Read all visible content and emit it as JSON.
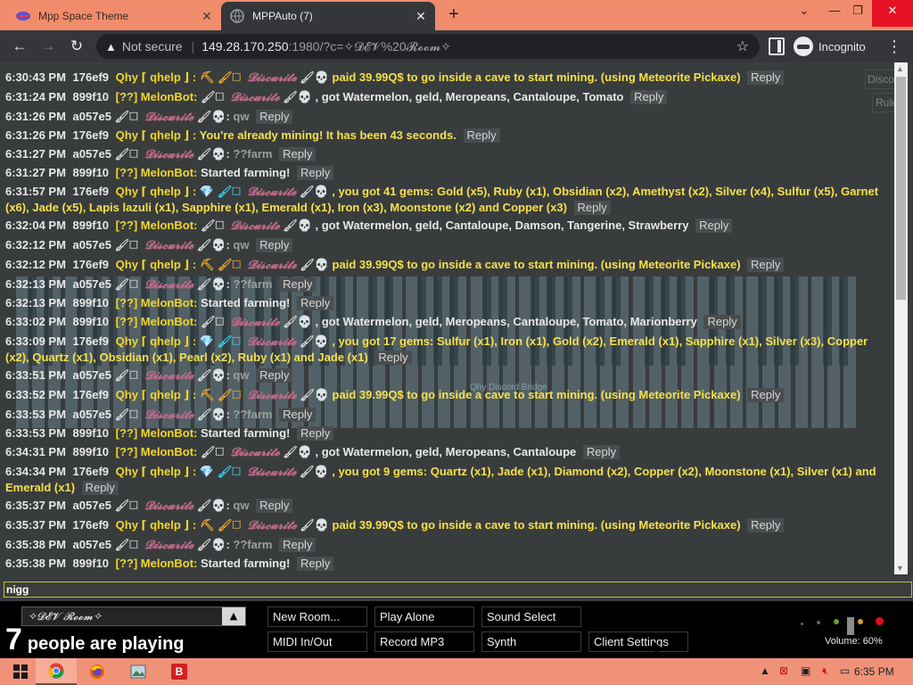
{
  "browser": {
    "tabs": [
      {
        "title": "Mpp Space Theme",
        "active": false
      },
      {
        "title": "MPPAuto (7)",
        "active": true
      }
    ],
    "address": {
      "security": "Not secure",
      "host": "149.28.170.250",
      "path": ":1980/?c=✧𝓓𝓔𝓥%20𝓡𝓸𝓸𝓶✧"
    },
    "profile_label": "Incognito"
  },
  "side_buttons": {
    "discord": "Discord",
    "rules": "Rules"
  },
  "piano_label": "Qhy Discord Bridge",
  "chat": {
    "messages": [
      {
        "time": "6:30:43 PM",
        "uid": "176ef9",
        "name": "Qhy ⌈ qhelp ⌋ :",
        "icons": "⛏ 🖌🗆",
        "target": "𝓓𝓲𝓼𝓬𝓾𝓻𝓲𝓽𝓮",
        "target_icons": "🖌💀",
        "text": "paid 39.99Q$ to go inside a cave to start mining. (using Meteorite Pickaxe)",
        "kind": "qhy"
      },
      {
        "time": "6:31:24 PM",
        "uid": "899f10",
        "name": "[??] MelonBot:",
        "icons": "🖌🗆",
        "target": "𝓓𝓲𝓼𝓬𝓾𝓻𝓲𝓽𝓮",
        "target_icons": "🖌💀",
        "text": ", got Watermelon, geld, Meropeans, Cantaloupe, Tomato",
        "kind": "melon"
      },
      {
        "time": "6:31:26 PM",
        "uid": "a057e5",
        "name": "",
        "icons": "🖌🗆",
        "target": "𝓓𝓲𝓼𝓬𝓾𝓻𝓲𝓽𝓮",
        "target_icons": "🖌💀:",
        "text": "qw",
        "kind": "disc"
      },
      {
        "time": "6:31:26 PM",
        "uid": "176ef9",
        "name": "Qhy ⌈ qhelp ⌋ :",
        "icons": "",
        "target": "",
        "target_icons": "",
        "text": "You're already mining! It has been 43 seconds.",
        "kind": "qhy"
      },
      {
        "time": "6:31:27 PM",
        "uid": "a057e5",
        "name": "",
        "icons": "🖌🗆",
        "target": "𝓓𝓲𝓼𝓬𝓾𝓻𝓲𝓽𝓮",
        "target_icons": "🖌💀:",
        "text": "??farm",
        "kind": "disc"
      },
      {
        "time": "6:31:27 PM",
        "uid": "899f10",
        "name": "[??] MelonBot:",
        "icons": "",
        "target": "",
        "target_icons": "",
        "text": "Started farming!",
        "kind": "melon_plain"
      },
      {
        "time": "6:31:57 PM",
        "uid": "176ef9",
        "name": "Qhy ⌈ qhelp ⌋ :",
        "icons": "💎 🖌🗆",
        "target": "𝓓𝓲𝓼𝓬𝓾𝓻𝓲𝓽𝓮",
        "target_icons": "🖌💀",
        "text": ", you got 41 gems: Gold (x5), Ruby (x1), Obsidian (x2), Amethyst (x2), Silver (x4), Sulfur (x5), Garnet (x6), Jade (x5), Lapis lazuli (x1), Sapphire (x1), Emerald (x1), Iron (x3), Moonstone (x2) and Copper (x3)",
        "kind": "qhy"
      },
      {
        "time": "6:32:04 PM",
        "uid": "899f10",
        "name": "[??] MelonBot:",
        "icons": "🖌🗆",
        "target": "𝓓𝓲𝓼𝓬𝓾𝓻𝓲𝓽𝓮",
        "target_icons": "🖌💀",
        "text": ", got Watermelon, geld, Cantaloupe, Damson, Tangerine, Strawberry",
        "kind": "melon"
      },
      {
        "time": "6:32:12 PM",
        "uid": "a057e5",
        "name": "",
        "icons": "🖌🗆",
        "target": "𝓓𝓲𝓼𝓬𝓾𝓻𝓲𝓽𝓮",
        "target_icons": "🖌💀:",
        "text": "qw",
        "kind": "disc"
      },
      {
        "time": "6:32:12 PM",
        "uid": "176ef9",
        "name": "Qhy ⌈ qhelp ⌋ :",
        "icons": "⛏ 🖌🗆",
        "target": "𝓓𝓲𝓼𝓬𝓾𝓻𝓲𝓽𝓮",
        "target_icons": "🖌💀",
        "text": "paid 39.99Q$ to go inside a cave to start mining. (using Meteorite Pickaxe)",
        "kind": "qhy"
      },
      {
        "time": "6:32:13 PM",
        "uid": "a057e5",
        "name": "",
        "icons": "🖌🗆",
        "target": "𝓓𝓲𝓼𝓬𝓾𝓻𝓲𝓽𝓮",
        "target_icons": "🖌💀:",
        "text": "??farm",
        "kind": "disc"
      },
      {
        "time": "6:32:13 PM",
        "uid": "899f10",
        "name": "[??] MelonBot:",
        "icons": "",
        "target": "",
        "target_icons": "",
        "text": "Started farming!",
        "kind": "melon_plain"
      },
      {
        "time": "6:33:02 PM",
        "uid": "899f10",
        "name": "[??] MelonBot:",
        "icons": "🖌🗆",
        "target": "𝓓𝓲𝓼𝓬𝓾𝓻𝓲𝓽𝓮",
        "target_icons": "🖌💀",
        "text": ", got Watermelon, geld, Meropeans, Cantaloupe, Tomato, Marionberry",
        "kind": "melon"
      },
      {
        "time": "6:33:09 PM",
        "uid": "176ef9",
        "name": "Qhy ⌈ qhelp ⌋ :",
        "icons": "💎 🖌🗆",
        "target": "𝓓𝓲𝓼𝓬𝓾𝓻𝓲𝓽𝓮",
        "target_icons": "🖌💀",
        "text": ", you got 17 gems: Sulfur (x1), Iron (x1), Gold (x2), Emerald (x1), Sapphire (x1), Silver (x3), Copper (x2), Quartz (x1), Obsidian (x1), Pearl (x2), Ruby (x1) and Jade (x1)",
        "kind": "qhy"
      },
      {
        "time": "6:33:51 PM",
        "uid": "a057e5",
        "name": "",
        "icons": "🖌🗆",
        "target": "𝓓𝓲𝓼𝓬𝓾𝓻𝓲𝓽𝓮",
        "target_icons": "🖌💀:",
        "text": "qw",
        "kind": "disc"
      },
      {
        "time": "6:33:52 PM",
        "uid": "176ef9",
        "name": "Qhy ⌈ qhelp ⌋ :",
        "icons": "⛏ 🖌🗆",
        "target": "𝓓𝓲𝓼𝓬𝓾𝓻𝓲𝓽𝓮",
        "target_icons": "🖌💀",
        "text": "paid 39.99Q$ to go inside a cave to start mining. (using Meteorite Pickaxe)",
        "kind": "qhy"
      },
      {
        "time": "6:33:53 PM",
        "uid": "a057e5",
        "name": "",
        "icons": "🖌🗆",
        "target": "𝓓𝓲𝓼𝓬𝓾𝓻𝓲𝓽𝓮",
        "target_icons": "🖌💀:",
        "text": "??farm",
        "kind": "disc"
      },
      {
        "time": "6:33:53 PM",
        "uid": "899f10",
        "name": "[??] MelonBot:",
        "icons": "",
        "target": "",
        "target_icons": "",
        "text": "Started farming!",
        "kind": "melon_plain"
      },
      {
        "time": "6:34:31 PM",
        "uid": "899f10",
        "name": "[??] MelonBot:",
        "icons": "🖌🗆",
        "target": "𝓓𝓲𝓼𝓬𝓾𝓻𝓲𝓽𝓮",
        "target_icons": "🖌💀",
        "text": ", got Watermelon, geld, Meropeans, Cantaloupe",
        "kind": "melon"
      },
      {
        "time": "6:34:34 PM",
        "uid": "176ef9",
        "name": "Qhy ⌈ qhelp ⌋ :",
        "icons": "💎 🖌🗆",
        "target": "𝓓𝓲𝓼𝓬𝓾𝓻𝓲𝓽𝓮",
        "target_icons": "🖌💀",
        "text": ", you got 9 gems: Quartz (x1), Jade (x1), Diamond (x2), Copper (x2), Moonstone (x1), Silver (x1) and Emerald (x1)",
        "kind": "qhy"
      },
      {
        "time": "6:35:37 PM",
        "uid": "a057e5",
        "name": "",
        "icons": "🖌🗆",
        "target": "𝓓𝓲𝓼𝓬𝓾𝓻𝓲𝓽𝓮",
        "target_icons": "🖌💀:",
        "text": "qw",
        "kind": "disc"
      },
      {
        "time": "6:35:37 PM",
        "uid": "176ef9",
        "name": "Qhy ⌈ qhelp ⌋ :",
        "icons": "⛏ 🖌🗆",
        "target": "𝓓𝓲𝓼𝓬𝓾𝓻𝓲𝓽𝓮",
        "target_icons": "🖌💀",
        "text": "paid 39.99Q$ to go inside a cave to start mining. (using Meteorite Pickaxe)",
        "kind": "qhy"
      },
      {
        "time": "6:35:38 PM",
        "uid": "a057e5",
        "name": "",
        "icons": "🖌🗆",
        "target": "𝓓𝓲𝓼𝓬𝓾𝓻𝓲𝓽𝓮",
        "target_icons": "🖌💀:",
        "text": "??farm",
        "kind": "disc"
      },
      {
        "time": "6:35:38 PM",
        "uid": "899f10",
        "name": "[??] MelonBot:",
        "icons": "",
        "target": "",
        "target_icons": "",
        "text": "Started farming!",
        "kind": "melon_plain"
      }
    ],
    "reply_label": "Reply",
    "input_value": "nigg"
  },
  "room": {
    "current": "✧𝓓𝓔𝓥 𝓡𝓸𝓸𝓶✧",
    "player_count": "7",
    "player_text": "people are playing"
  },
  "controls": {
    "new_room": "New Room...",
    "play_alone": "Play Alone",
    "sound_select": "Sound Select",
    "midi": "MIDI In/Out",
    "record": "Record MP3",
    "synth": "Synth",
    "client_settings": "Client Settings"
  },
  "volume": {
    "label": "Volume: 60%",
    "value": 0.6
  },
  "taskbar": {
    "clock": "6:35 PM"
  },
  "colors": {
    "tabstrip": "#f08c6c",
    "qhy_name": "#f0d62a",
    "chat_text": "#f5e04a",
    "disc_name": "#c06a8a",
    "taskbar": "#f09278"
  }
}
